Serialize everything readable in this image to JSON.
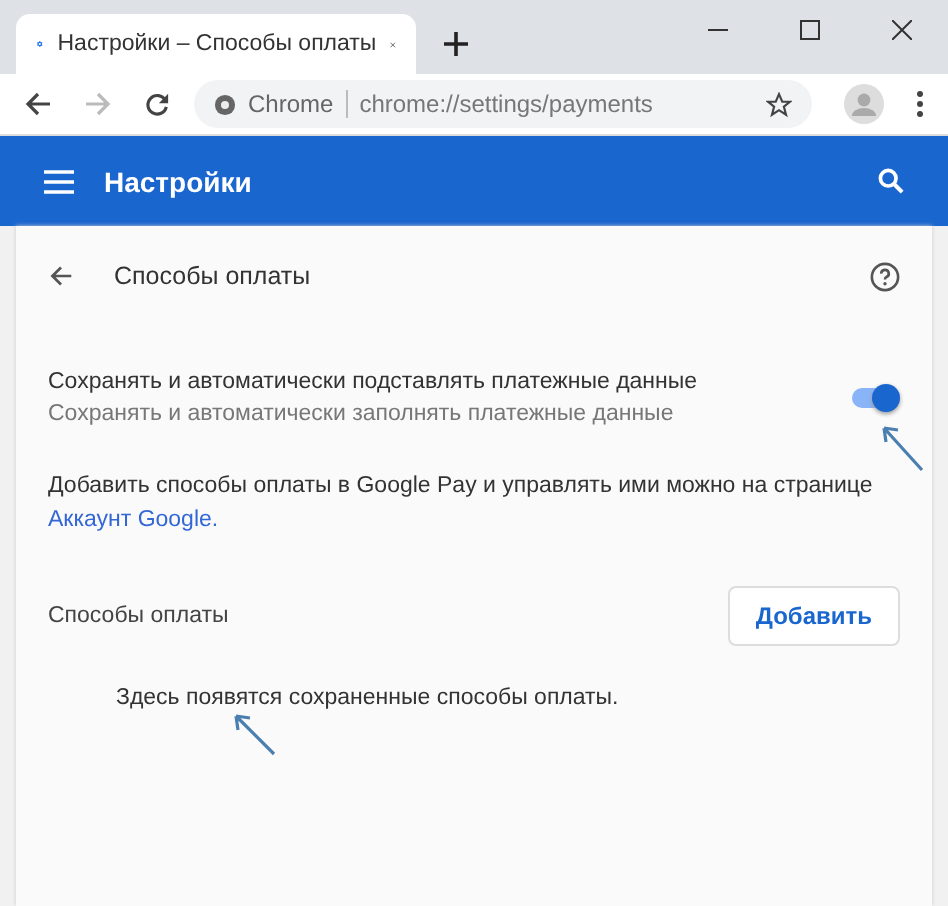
{
  "browser": {
    "tab_title": "Настройки – Способы оплаты",
    "address_chip": "Chrome",
    "url": "chrome://settings/payments"
  },
  "header": {
    "title": "Настройки"
  },
  "page": {
    "title": "Способы оплаты",
    "setting": {
      "label": "Сохранять и автоматически подставлять платежные данные",
      "description": "Сохранять и автоматически заполнять платежные данные",
      "on": true
    },
    "info": "Добавить способы оплаты в Google Pay и управлять ими можно на странице",
    "link": "Аккаунт Google.",
    "section": {
      "title": "Способы оплаты",
      "button": "Добавить",
      "empty_text": "Здесь появятся сохраненные способы оплаты."
    }
  }
}
